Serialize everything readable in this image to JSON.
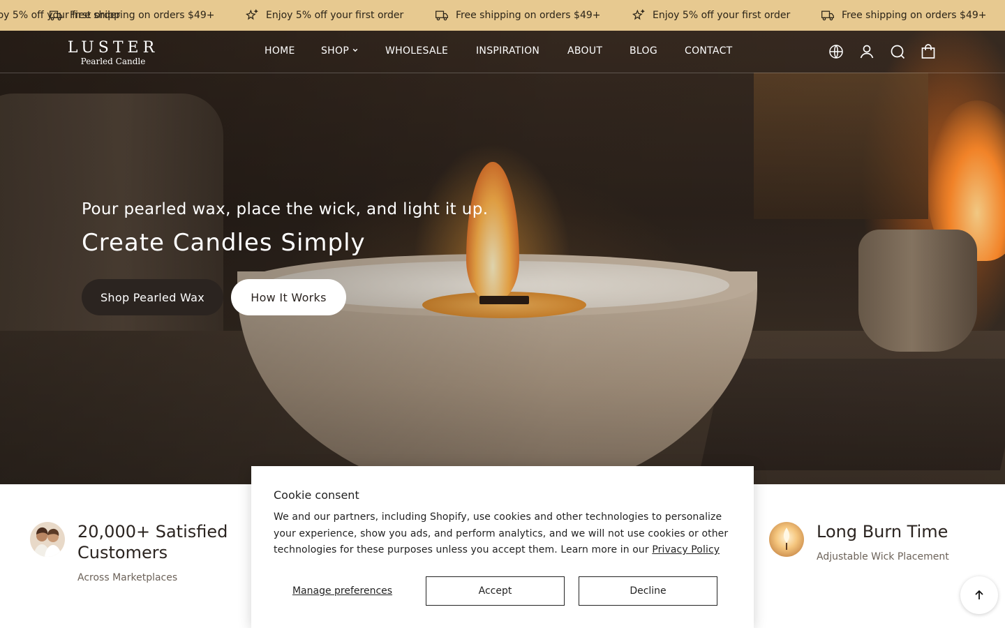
{
  "announcement": {
    "items": [
      {
        "text": "Enjoy 5% off your first order",
        "icon": "stars-icon"
      },
      {
        "text": "Free shipping on orders $49+",
        "icon": "truck-icon"
      },
      {
        "text": "Enjoy 5% off your first order",
        "icon": "stars-icon"
      },
      {
        "text": "Free shipping on orders $49+",
        "icon": "truck-icon"
      },
      {
        "text": "Enjoy 5% off your first order",
        "icon": "stars-icon"
      },
      {
        "text": "Free shipping on orders $49+",
        "icon": "truck-icon"
      }
    ],
    "background": "#e7c990"
  },
  "header": {
    "logo": {
      "main": "LUSTER",
      "sub": "Pearled Candle"
    },
    "nav": [
      "HOME",
      "SHOP",
      "WHOLESALE",
      "INSPIRATION",
      "ABOUT",
      "BLOG",
      "CONTACT"
    ],
    "icons": [
      "globe-icon",
      "account-icon",
      "search-icon",
      "cart-icon"
    ]
  },
  "hero": {
    "subtitle": "Pour pearled wax, place the wick, and light it up.",
    "title": "Create Candles Simply",
    "primary_button": "Shop Pearled Wax",
    "secondary_button": "How It Works"
  },
  "features": [
    {
      "title": "20,000+ Satisfied Customers",
      "subtitle": "Across Marketplaces"
    },
    {
      "title": "Long Burn Time",
      "subtitle": "Adjustable Wick Placement"
    }
  ],
  "cookie": {
    "title": "Cookie consent",
    "body": "We and our partners, including Shopify, use cookies and other technologies to personalize your experience, show you ads, and perform analytics, and we will not use cookies or other technologies for these purposes unless you accept them. Learn more in our",
    "link": "Privacy Policy",
    "manage": "Manage preferences",
    "accept": "Accept",
    "decline": "Decline"
  }
}
